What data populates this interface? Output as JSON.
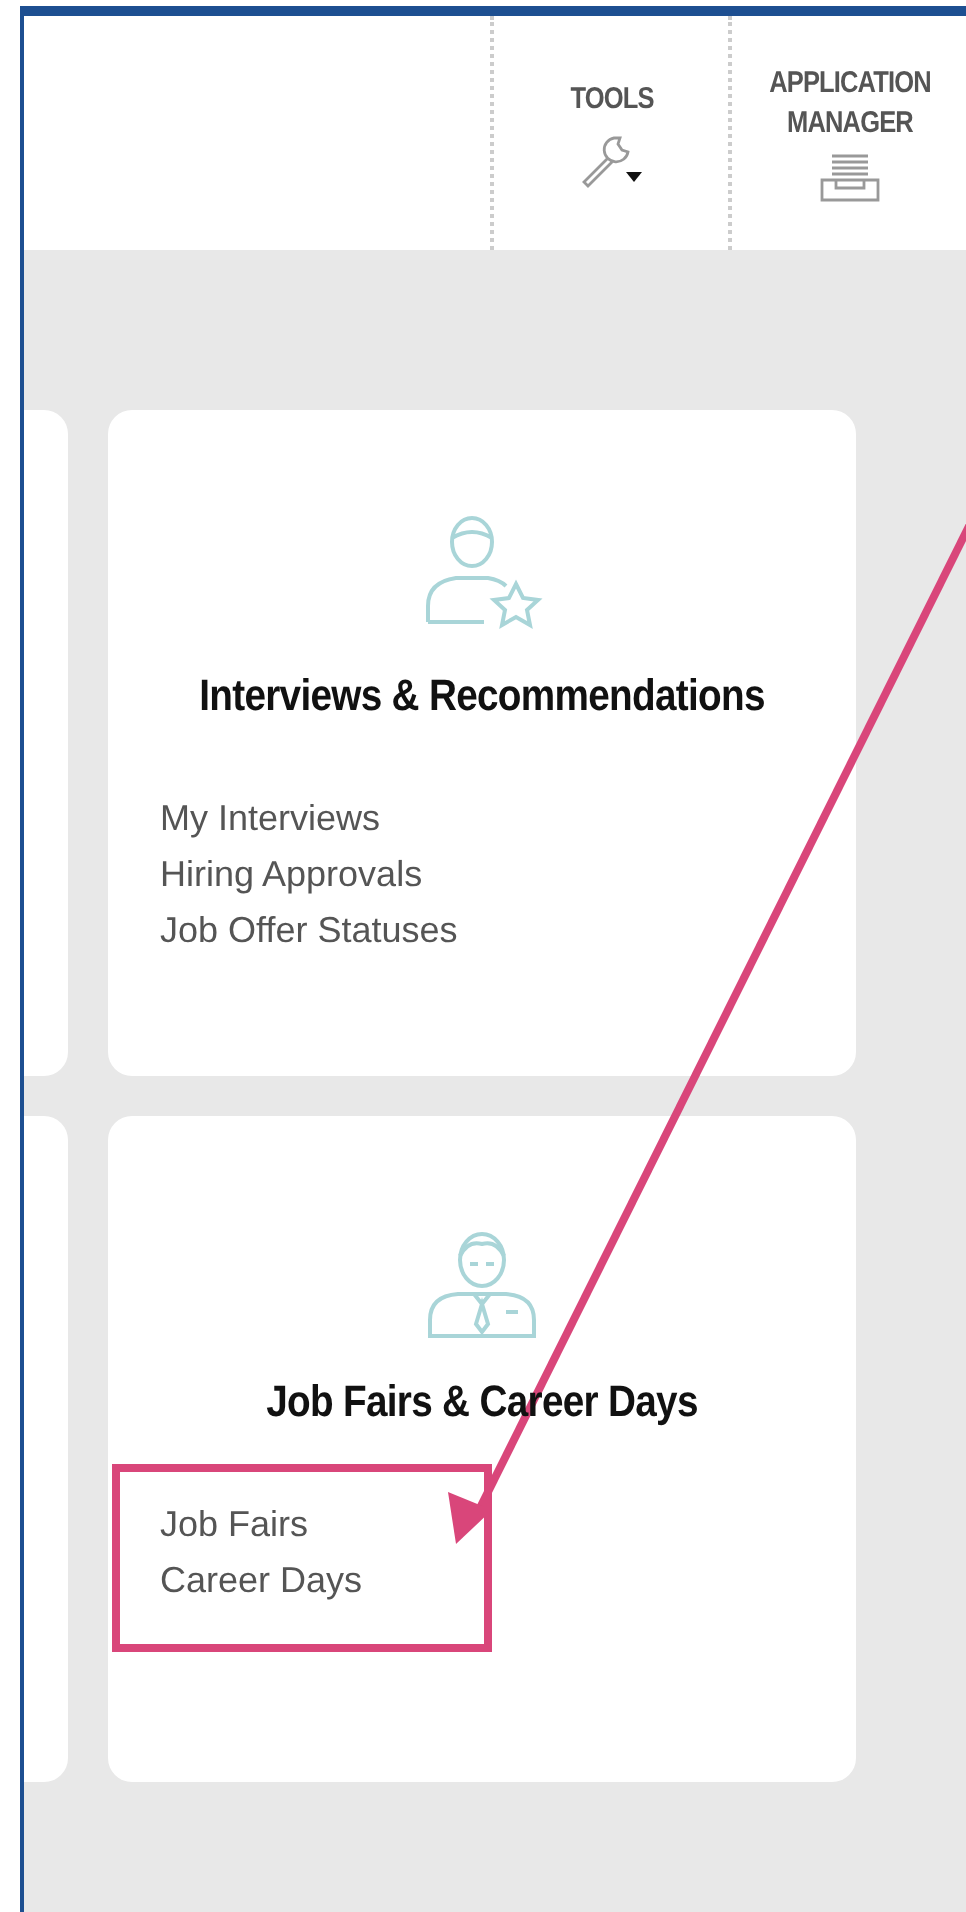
{
  "toolbar": [
    {
      "label": "TOOLS",
      "kind": "tools"
    },
    {
      "label": "APPLICATION MANAGER",
      "kind": "manager"
    }
  ],
  "cards": [
    {
      "title": "Interviews & Recommendations",
      "kind": "interviews",
      "links": [
        "My Interviews",
        "Hiring Approvals",
        "Job Offer Statuses"
      ]
    },
    {
      "title": "Job Fairs & Career Days",
      "kind": "fairs",
      "links": [
        "Job Fairs",
        "Career Days"
      ]
    }
  ]
}
